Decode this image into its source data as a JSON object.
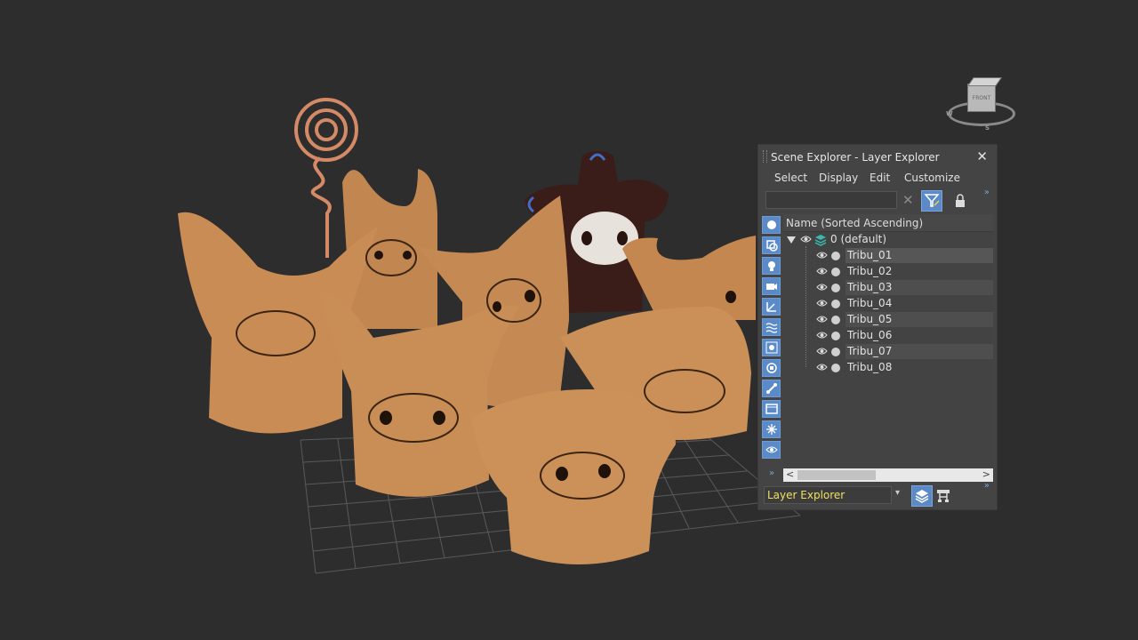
{
  "viewport": {
    "viewcube_face": "FRONT",
    "compass": [
      "W",
      "S"
    ]
  },
  "panel": {
    "title": "Scene Explorer - Layer Explorer",
    "close_icon": "close-icon",
    "menu": [
      "Select",
      "Display",
      "Edit",
      "Customize"
    ],
    "search_value": "",
    "column_header": "Name (Sorted Ascending)",
    "root_layer": "0 (default)",
    "objects": [
      "Tribu_01",
      "Tribu_02",
      "Tribu_03",
      "Tribu_04",
      "Tribu_05",
      "Tribu_06",
      "Tribu_07",
      "Tribu_08"
    ],
    "explorer_mode": "Layer Explorer",
    "accent": "#5b8ac7",
    "tool_icons": [
      "display-geometry-icon",
      "display-shapes-icon",
      "display-lights-icon",
      "display-cameras-icon",
      "display-helpers-icon",
      "display-spacewarps-icon",
      "display-groups-icon",
      "display-xrefs-icon",
      "display-bones-icon",
      "display-containers-icon",
      "display-frozen-icon",
      "display-hidden-icon"
    ]
  }
}
